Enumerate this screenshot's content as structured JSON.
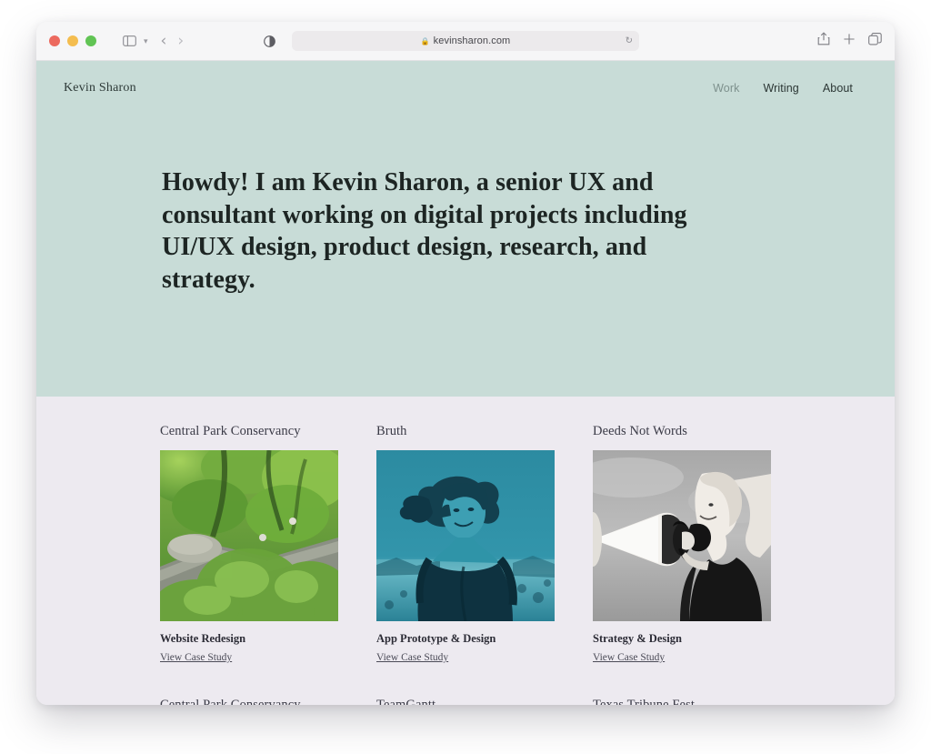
{
  "browser": {
    "url": "kevinsharon.com",
    "lock_icon": "lock-icon",
    "reload_icon": "reload-icon",
    "sidebar_icon": "sidebar-toggle-icon",
    "back_icon": "back-arrow-icon",
    "forward_icon": "forward-arrow-icon",
    "reader_icon": "reader-mode-icon",
    "share_icon": "share-icon",
    "newtab_icon": "plus-icon",
    "tabs_icon": "tab-overview-icon",
    "traffic_lights": [
      "close",
      "minimize",
      "zoom"
    ]
  },
  "site": {
    "logo": "Kevin Sharon",
    "nav": [
      {
        "label": "Work",
        "muted": true
      },
      {
        "label": "Writing",
        "muted": false
      },
      {
        "label": "About",
        "muted": false
      }
    ],
    "hero_headline": "Howdy! I am Kevin Sharon, a senior UX and consultant working on digital projects including UI/UX design, product design, research, and strategy.",
    "colors": {
      "hero_bg": "#c8dcd7",
      "work_bg": "#edeaf0",
      "text": "#1d2523",
      "duotone_teal": "#2d8ba0"
    },
    "projects_row1": [
      {
        "title": "Central Park Conservancy",
        "subtitle": "Website Redesign",
        "link": "View Case Study",
        "image": "green-park-stone-wall-photo"
      },
      {
        "title": "Bruth",
        "subtitle": "App Prototype & Design",
        "link": "View Case Study",
        "image": "teal-duotone-woman-portrait-photo"
      },
      {
        "title": "Deeds Not Words",
        "subtitle": "Strategy & Design",
        "link": "View Case Study",
        "image": "bw-woman-megaphone-photo"
      }
    ],
    "projects_row2": [
      {
        "title": "Central Park Conservancy"
      },
      {
        "title": "TeamGantt"
      },
      {
        "title": "Texas Tribune Fest"
      }
    ]
  }
}
